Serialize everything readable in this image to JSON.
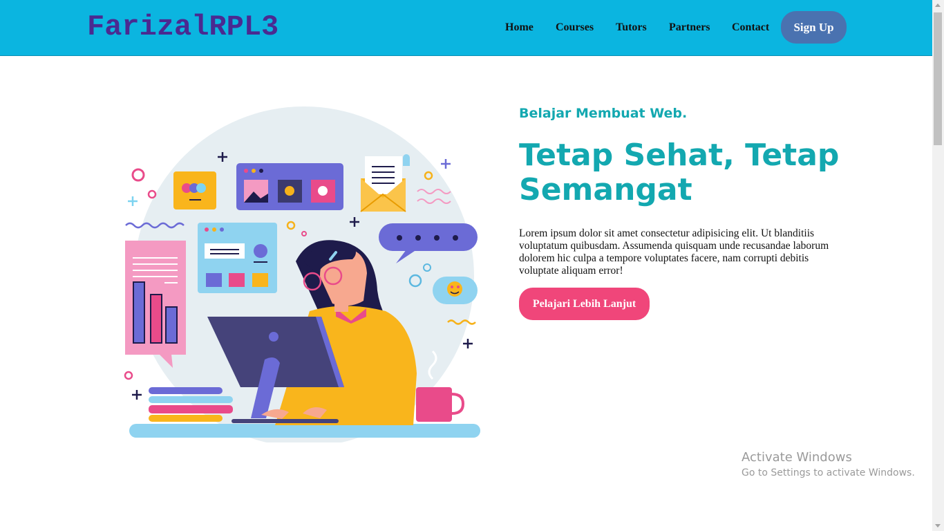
{
  "brand": {
    "logo": "FarizalRPL3"
  },
  "nav": {
    "items": [
      {
        "label": "Home"
      },
      {
        "label": "Courses"
      },
      {
        "label": "Tutors"
      },
      {
        "label": "Partners"
      },
      {
        "label": "Contact"
      }
    ],
    "signup_label": "Sign Up"
  },
  "hero": {
    "tagline": "Belajar Membuat Web.",
    "headline": "Tetap Sehat, Tetap Semangat",
    "description": "Lorem ipsum dolor sit amet consectetur adipisicing elit. Ut blanditiis voluptatum quibusdam. Assumenda quisquam unde recusandae laborum dolorem hic culpa a tempore voluptates facere, nam corrupti debitis voluptate aliquam error!",
    "cta_label": "Pelajari Lebih Lanjut"
  },
  "watermark": {
    "title": "Activate Windows",
    "subtitle": "Go to Settings to activate Windows."
  },
  "colors": {
    "navbar": "#0bb5e0",
    "logo": "#4a2a91",
    "signup": "#4a72b0",
    "accent_text": "#13a8b0",
    "cta": "#f0467a"
  }
}
